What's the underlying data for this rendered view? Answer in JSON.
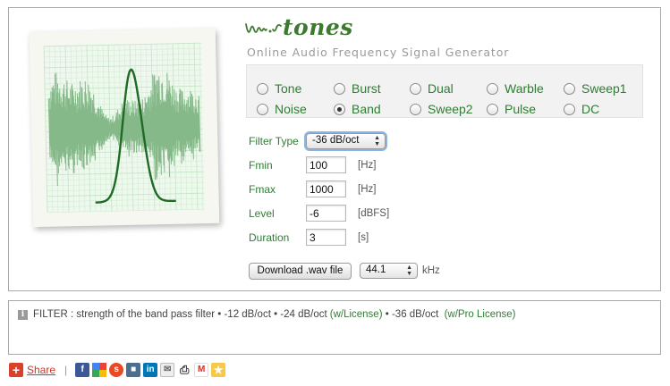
{
  "logo": {
    "text": "tones"
  },
  "subtitle": "Online Audio Frequency Signal Generator",
  "modes": [
    {
      "label": "Tone",
      "checked": false
    },
    {
      "label": "Burst",
      "checked": false
    },
    {
      "label": "Dual",
      "checked": false
    },
    {
      "label": "Warble",
      "checked": false
    },
    {
      "label": "Sweep1",
      "checked": false
    },
    {
      "label": "Noise",
      "checked": false
    },
    {
      "label": "Band",
      "checked": true
    },
    {
      "label": "Sweep2",
      "checked": false
    },
    {
      "label": "Pulse",
      "checked": false
    },
    {
      "label": "DC",
      "checked": false
    }
  ],
  "form": {
    "filter_type": {
      "label": "Filter Type",
      "value": "-36 dB/oct"
    },
    "fmin": {
      "label": "Fmin",
      "value": "100",
      "unit": "[Hz]"
    },
    "fmax": {
      "label": "Fmax",
      "value": "1000",
      "unit": "[Hz]"
    },
    "level": {
      "label": "Level",
      "value": "-6",
      "unit": "[dBFS]"
    },
    "duration": {
      "label": "Duration",
      "value": "3",
      "unit": "[s]"
    }
  },
  "download": {
    "button_label": "Download .wav file",
    "sample_rate": "44.1",
    "sample_rate_unit": "kHz"
  },
  "info": {
    "prefix": "FILTER : strength of the band pass filter • -12 dB/oct • -24 dB/oct ",
    "license": "(w/License)",
    "middle": " • -36 dB/oct ",
    "pro_license": "(w/Pro License)"
  },
  "share": {
    "label": "Share",
    "separator": "|"
  },
  "colors": {
    "accent_green": "#2e7d32",
    "logo_green": "#3d7a2f",
    "noise_green": "#86b98a",
    "curve_green": "#1f6b24",
    "grid_green": "#c6e6c6",
    "share_red": "#c43a2a"
  },
  "icons": {
    "share": "plus-icon",
    "social": [
      "facebook-icon",
      "google-icon",
      "stumbleupon-icon",
      "linkedin-icon",
      "email-icon",
      "print-icon",
      "gmail-icon",
      "favorites-icon"
    ]
  }
}
